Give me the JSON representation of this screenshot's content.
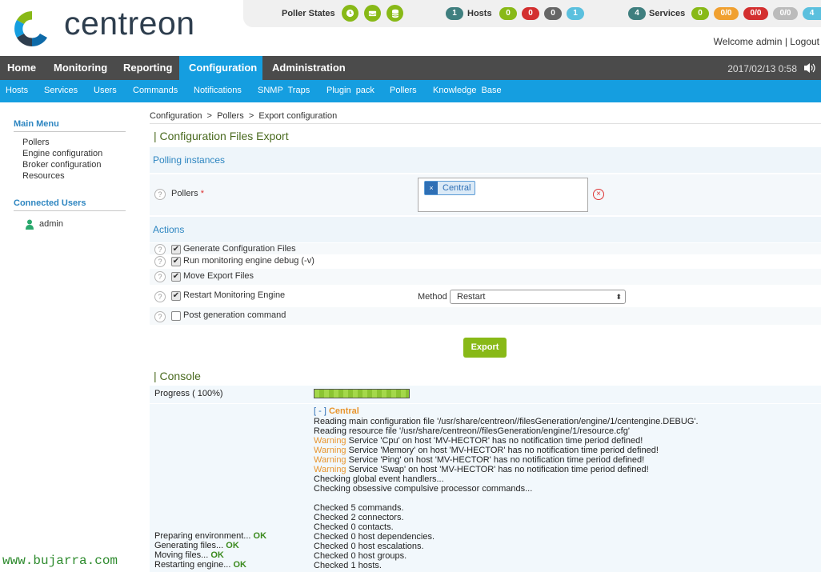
{
  "brand": {
    "name": "centreon",
    "colors": {
      "green": "#88b917",
      "blue": "#159ee0",
      "nav": "#4b4b4b",
      "orange": "#e8952e",
      "red": "#d32f2f"
    }
  },
  "status_bar": {
    "poller_label": "Poller States",
    "poller_icons": [
      "clock-icon",
      "inbox-icon",
      "database-icon"
    ],
    "hosts_label": "Hosts",
    "hosts_total": "1",
    "hosts_counts": [
      "0",
      "0",
      "0",
      "1"
    ],
    "services_label": "Services",
    "services_total": "4",
    "services_counts": [
      "0",
      "0/0",
      "0/0",
      "0/0",
      "4"
    ]
  },
  "user": {
    "welcome": "Welcome admin",
    "separator": "|",
    "logout": "Logout"
  },
  "nav": {
    "items": [
      "Home",
      "Monitoring",
      "Reporting",
      "Configuration",
      "Administration"
    ],
    "active": "Configuration",
    "datetime": "2017/02/13 0:58"
  },
  "subnav": {
    "items": [
      "Hosts",
      "Services",
      "Users",
      "Commands",
      "Notifications",
      "SNMP  Traps",
      "Plugin  pack",
      "Pollers",
      "Knowledge  Base"
    ]
  },
  "sidebar": {
    "main_menu_title": "Main Menu",
    "main_menu": [
      "Pollers",
      "Engine configuration",
      "Broker configuration",
      "Resources"
    ],
    "connected_title": "Connected Users",
    "connected": [
      "admin"
    ]
  },
  "breadcrumb": "Configuration  >  Pollers  >  Export configuration",
  "page_title": "| Configuration Files Export",
  "polling": {
    "title": "Polling instances",
    "pollers_label": "Pollers",
    "required_mark": "*",
    "selected_tag": "Central",
    "tag_remove": "×",
    "clear": "×"
  },
  "actions": {
    "title": "Actions",
    "items": [
      {
        "label": "Generate Configuration Files",
        "checked": true
      },
      {
        "label": "Run monitoring engine debug (-v)",
        "checked": true
      },
      {
        "label": "Move Export Files",
        "checked": true
      },
      {
        "label": "Restart Monitoring Engine",
        "checked": true
      },
      {
        "label": "Post generation command",
        "checked": false
      }
    ],
    "method_label": "Method",
    "method_value": "Restart",
    "help": "?",
    "check_mark": "✔"
  },
  "export_button": "Export",
  "console": {
    "title": "| Console",
    "progress_label": "Progress ( 100%)",
    "progress": 1.0,
    "poller_toggle": "[ - ]",
    "poller_name": "Central",
    "lines": [
      {
        "text": "Reading main configuration file '/usr/share/centreon//filesGeneration/engine/1/centengine.DEBUG'."
      },
      {
        "text": "Reading resource file '/usr/share/centreon//filesGeneration/engine/1/resource.cfg'"
      },
      {
        "warn": "Warning",
        "text": " Service 'Cpu' on host 'MV-HECTOR' has no notification time period defined!"
      },
      {
        "warn": "Warning",
        "text": " Service 'Memory' on host 'MV-HECTOR' has no notification time period defined!"
      },
      {
        "warn": "Warning",
        "text": " Service 'Ping' on host 'MV-HECTOR' has no notification time period defined!"
      },
      {
        "warn": "Warning",
        "text": " Service 'Swap' on host 'MV-HECTOR' has no notification time period defined!"
      },
      {
        "text": "Checking global event handlers..."
      },
      {
        "text": "Checking obsessive compulsive processor commands..."
      },
      {
        "text": ""
      },
      {
        "text": "Checked 5 commands."
      },
      {
        "text": "Checked 2 connectors."
      },
      {
        "text": "Checked 0 contacts."
      },
      {
        "text": "Checked 0 host dependencies."
      },
      {
        "text": "Checked 0 host escalations."
      },
      {
        "text": "Checked 0 host groups."
      },
      {
        "text": "Checked 1 hosts."
      }
    ],
    "steps": [
      {
        "label": "Preparing environment...",
        "status": "OK"
      },
      {
        "label": "Generating files...",
        "status": "OK"
      },
      {
        "label": "Moving files...",
        "status": "OK"
      },
      {
        "label": "Restarting engine...",
        "status": "OK"
      }
    ]
  },
  "watermark": "www.bujarra.com"
}
